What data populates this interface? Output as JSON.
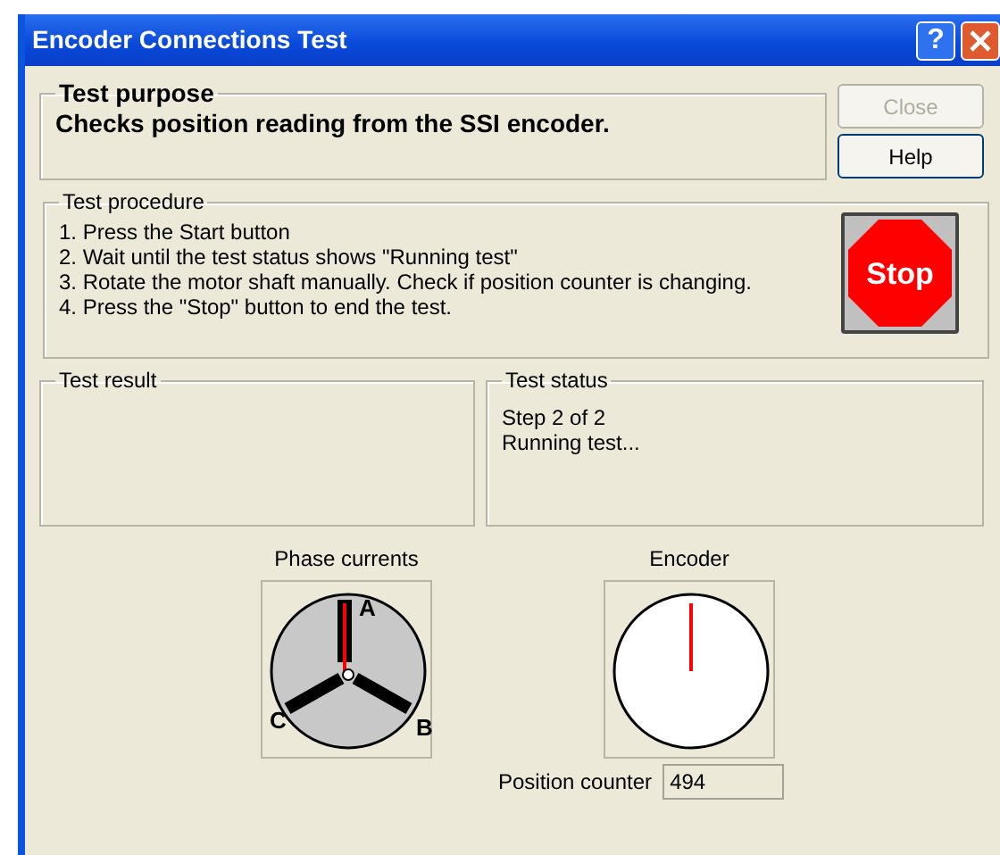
{
  "window": {
    "title": "Encoder Connections Test",
    "title_buttons": [
      {
        "kind": "help",
        "label": "?"
      },
      {
        "kind": "close"
      }
    ]
  },
  "purpose": {
    "legend": "Test purpose",
    "text": "Checks position reading from the SSI encoder."
  },
  "buttons": [
    {
      "label": "Close",
      "disabled": true
    },
    {
      "label": "Help",
      "disabled": false
    }
  ],
  "procedure": {
    "legend": "Test procedure",
    "steps": [
      "1. Press the Start button",
      "2. Wait until the test status shows \"Running test\"",
      "3. Rotate the motor shaft manually. Check if position counter is changing.",
      "4. Press the \"Stop\" button to end the test."
    ],
    "stop_button": "Stop"
  },
  "result": {
    "legend": "Test result"
  },
  "status": {
    "legend": "Test status",
    "lines": [
      "Step 2 of 2",
      "Running test..."
    ]
  },
  "phase_currents": {
    "label": "Phase currents",
    "phases": [
      "A",
      "B",
      "C"
    ]
  },
  "encoder": {
    "label": "Encoder"
  },
  "position_counter": {
    "label": "Position counter",
    "value": "494"
  }
}
